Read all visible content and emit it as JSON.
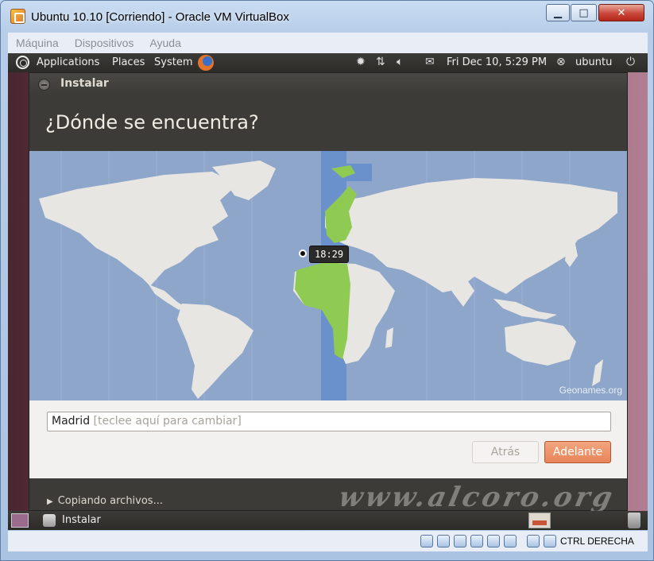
{
  "window": {
    "title": "Ubuntu 10.10 [Corriendo] - Oracle VM VirtualBox",
    "min_glyph": "▁",
    "max_glyph": "□",
    "close_glyph": "✕"
  },
  "vbox_menu": [
    "Máquina",
    "Dispositivos",
    "Ayuda"
  ],
  "top_panel": {
    "menus": [
      "Applications",
      "Places",
      "System"
    ],
    "clock": "Fri Dec 10,  5:29 PM",
    "user": "ubuntu"
  },
  "installer": {
    "window_title": "Instalar",
    "question": "¿Dónde se encuentra?",
    "map_credit": "Geonames.org",
    "time_tooltip": "18:29",
    "location": {
      "value": "Madrid",
      "hint": "[teclee aquí para cambiar]"
    },
    "back_label": "Atrás",
    "next_label": "Adelante",
    "progress_label": "Copiando archivos...",
    "watermark": "www.alcoro.org"
  },
  "taskbar": {
    "task_label": "Instalar"
  },
  "statusbar": {
    "host_key": "CTRL DERECHA"
  },
  "colors": {
    "map_sea": "#8ea6c9",
    "land": "#e8e6e2",
    "timezone_band": "#6b91cc",
    "selected_zone": "#8fcb52",
    "accent_button": "#e8845a"
  }
}
